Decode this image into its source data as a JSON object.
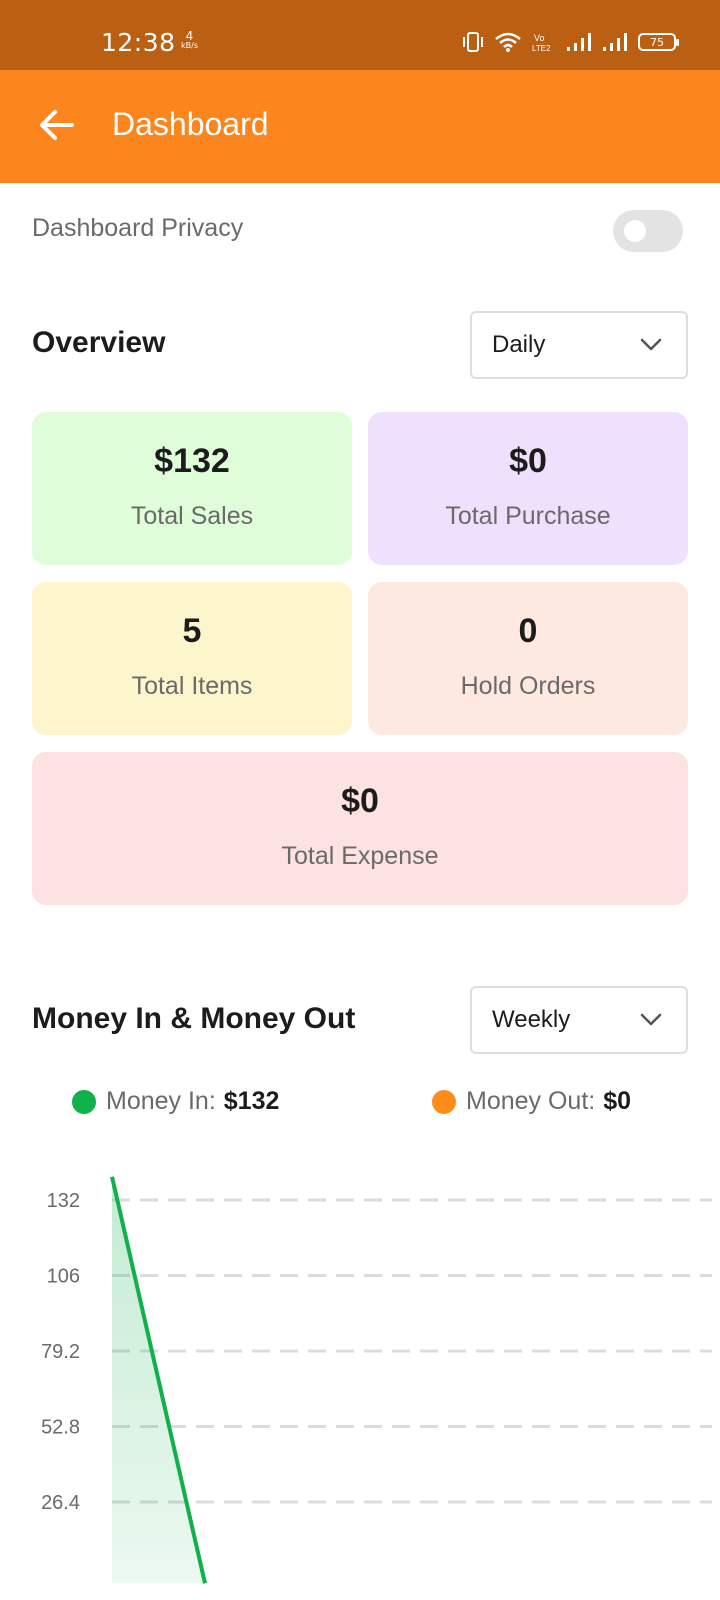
{
  "status_bar": {
    "time": "12:38",
    "net_speed_value": "4",
    "net_speed_unit": "kB/s",
    "battery_level": "75",
    "icons": [
      "vibrate-icon",
      "wifi-icon",
      "volte-icon",
      "signal-icon",
      "signal-icon",
      "battery-icon"
    ]
  },
  "app_bar": {
    "title": "Dashboard",
    "back_icon": "arrow-left-icon",
    "background": "#fd851e"
  },
  "privacy": {
    "label": "Dashboard Privacy",
    "enabled": false
  },
  "overview": {
    "title": "Overview",
    "period": "Daily",
    "cards": [
      {
        "value": "$132",
        "label": "Total Sales",
        "color": "#dffdd9"
      },
      {
        "value": "$0",
        "label": "Total Purchase",
        "color": "#efe0fd"
      },
      {
        "value": "5",
        "label": "Total Items",
        "color": "#fdf6cd"
      },
      {
        "value": "0",
        "label": "Hold Orders",
        "color": "#fde9e0"
      },
      {
        "value": "$0",
        "label": "Total Expense",
        "color": "#fde2e2"
      }
    ]
  },
  "money": {
    "title": "Money In & Money Out",
    "period": "Weekly",
    "legend": {
      "in_label": "Money In:",
      "in_value": "$132",
      "in_color": "#10b04a",
      "out_label": "Money Out:",
      "out_value": "$0",
      "out_color": "#fd8c1a"
    }
  },
  "chart_data": {
    "type": "area",
    "y_ticks": [
      "132",
      "106",
      "79.2",
      "52.8",
      "26.4"
    ],
    "ylim": [
      0,
      140
    ],
    "grid": true,
    "series": [
      {
        "name": "Money In",
        "color": "#10b04a",
        "x": [
          0,
          1
        ],
        "values": [
          140,
          0
        ]
      }
    ]
  }
}
